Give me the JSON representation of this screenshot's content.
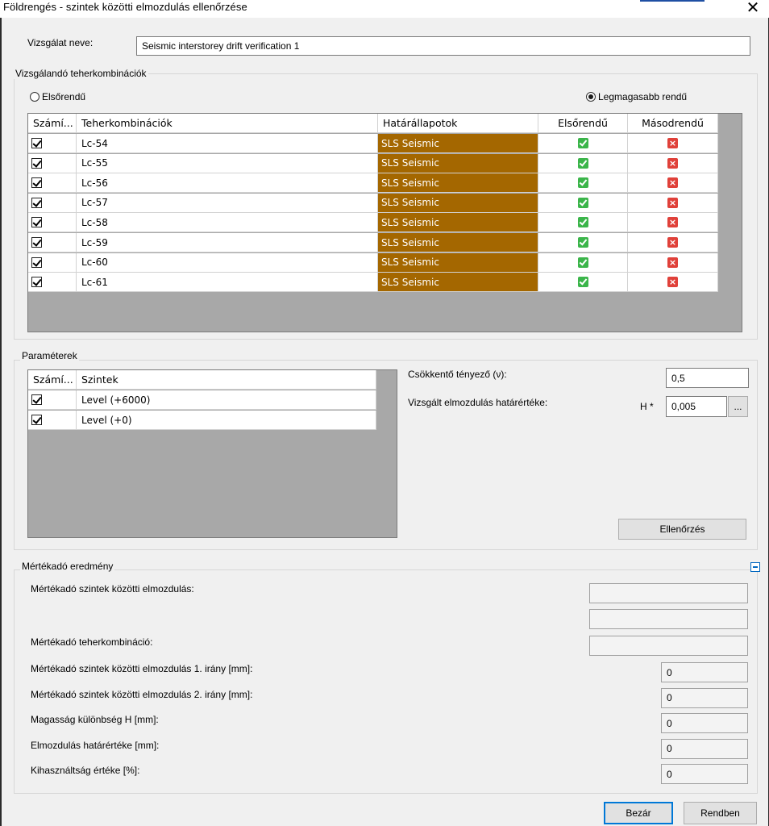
{
  "window": {
    "title": "Földrengés - szintek közötti elmozdulás ellenőrzése",
    "close_glyph": "✕"
  },
  "test_name": {
    "label": "Vizsgálat neve:",
    "value": "Seismic interstorey drift verification 1"
  },
  "combinations_group": {
    "title": "Vizsgálandó teherkombinációk",
    "radio_first": "Elsőrendű",
    "radio_highest": "Legmagasabb rendű",
    "selected": "highest",
    "columns": [
      "Számí...",
      "Teherkombinációk",
      "Határállapotok",
      "Elsőrendű",
      "Másodrendű"
    ],
    "rows": [
      {
        "checked": true,
        "name": "Lc-54",
        "limit_state": "SLS Seismic",
        "first_order": true,
        "second_order": false
      },
      {
        "checked": true,
        "name": "Lc-55",
        "limit_state": "SLS Seismic",
        "first_order": true,
        "second_order": false
      },
      {
        "checked": true,
        "name": "Lc-56",
        "limit_state": "SLS Seismic",
        "first_order": true,
        "second_order": false
      },
      {
        "checked": true,
        "name": "Lc-57",
        "limit_state": "SLS Seismic",
        "first_order": true,
        "second_order": false
      },
      {
        "checked": true,
        "name": "Lc-58",
        "limit_state": "SLS Seismic",
        "first_order": true,
        "second_order": false
      },
      {
        "checked": true,
        "name": "Lc-59",
        "limit_state": "SLS Seismic",
        "first_order": true,
        "second_order": false
      },
      {
        "checked": true,
        "name": "Lc-60",
        "limit_state": "SLS Seismic",
        "first_order": true,
        "second_order": false
      },
      {
        "checked": true,
        "name": "Lc-61",
        "limit_state": "SLS Seismic",
        "first_order": true,
        "second_order": false
      }
    ]
  },
  "parameters_group": {
    "title": "Paraméterek",
    "columns": [
      "Számí...",
      "Szintek"
    ],
    "rows": [
      {
        "checked": true,
        "name": "Level (+6000)"
      },
      {
        "checked": true,
        "name": "Level (+0)"
      }
    ],
    "reduction_label": "Csökkentő tényező (ν):",
    "reduction_value": "0,5",
    "limit_label": "Vizsgált elmozdulás határértéke:",
    "limit_prefix": "H *",
    "limit_value": "0,005",
    "limit_browse": "...",
    "check_button": "Ellenőrzés"
  },
  "result_group": {
    "title": "Mértékadó eredmény",
    "drift_label": "Mértékadó szintek közötti elmozdulás:",
    "combination_label": "Mértékadó teherkombináció:",
    "rows": [
      {
        "label": "Mértékadó szintek közötti elmozdulás 1. irány [mm]:",
        "value": "0"
      },
      {
        "label": "Mértékadó szintek közötti elmozdulás 2. irány [mm]:",
        "value": "0"
      },
      {
        "label": "Magasság különbség H [mm]:",
        "value": "0"
      },
      {
        "label": "Elmozdulás határértéke [mm]:",
        "value": "0"
      },
      {
        "label": "Kihasználtság értéke [%]:",
        "value": "0"
      }
    ]
  },
  "footer": {
    "close_button": "Bezár",
    "ok_button": "Rendben"
  },
  "colors": {
    "limit_state_bg": "#a46700",
    "ok_green": "#3bb54a",
    "fail_red": "#e0413a"
  }
}
